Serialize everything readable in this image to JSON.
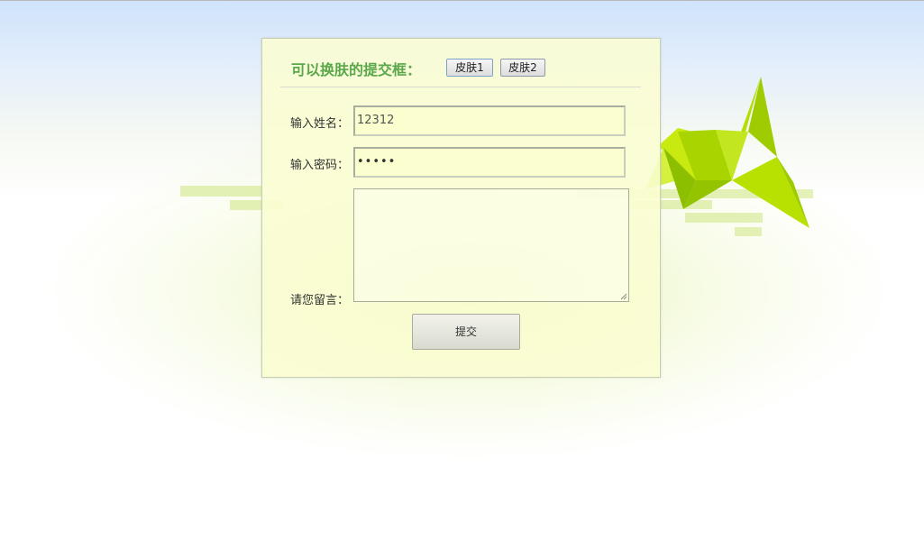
{
  "form": {
    "title": "可以换肤的提交框：",
    "skin_buttons": [
      "皮肤1",
      "皮肤2"
    ],
    "name_label": "输入姓名：",
    "name_value": "12312",
    "password_label": "输入密码：",
    "password_value": "•••••",
    "message_label": "请您留言：",
    "message_value": "",
    "submit_label": "提交"
  },
  "decor": {
    "crane_icon": "paper-crane-icon",
    "accent_color": "#5aa84a",
    "crane_color": "#b8e000"
  }
}
